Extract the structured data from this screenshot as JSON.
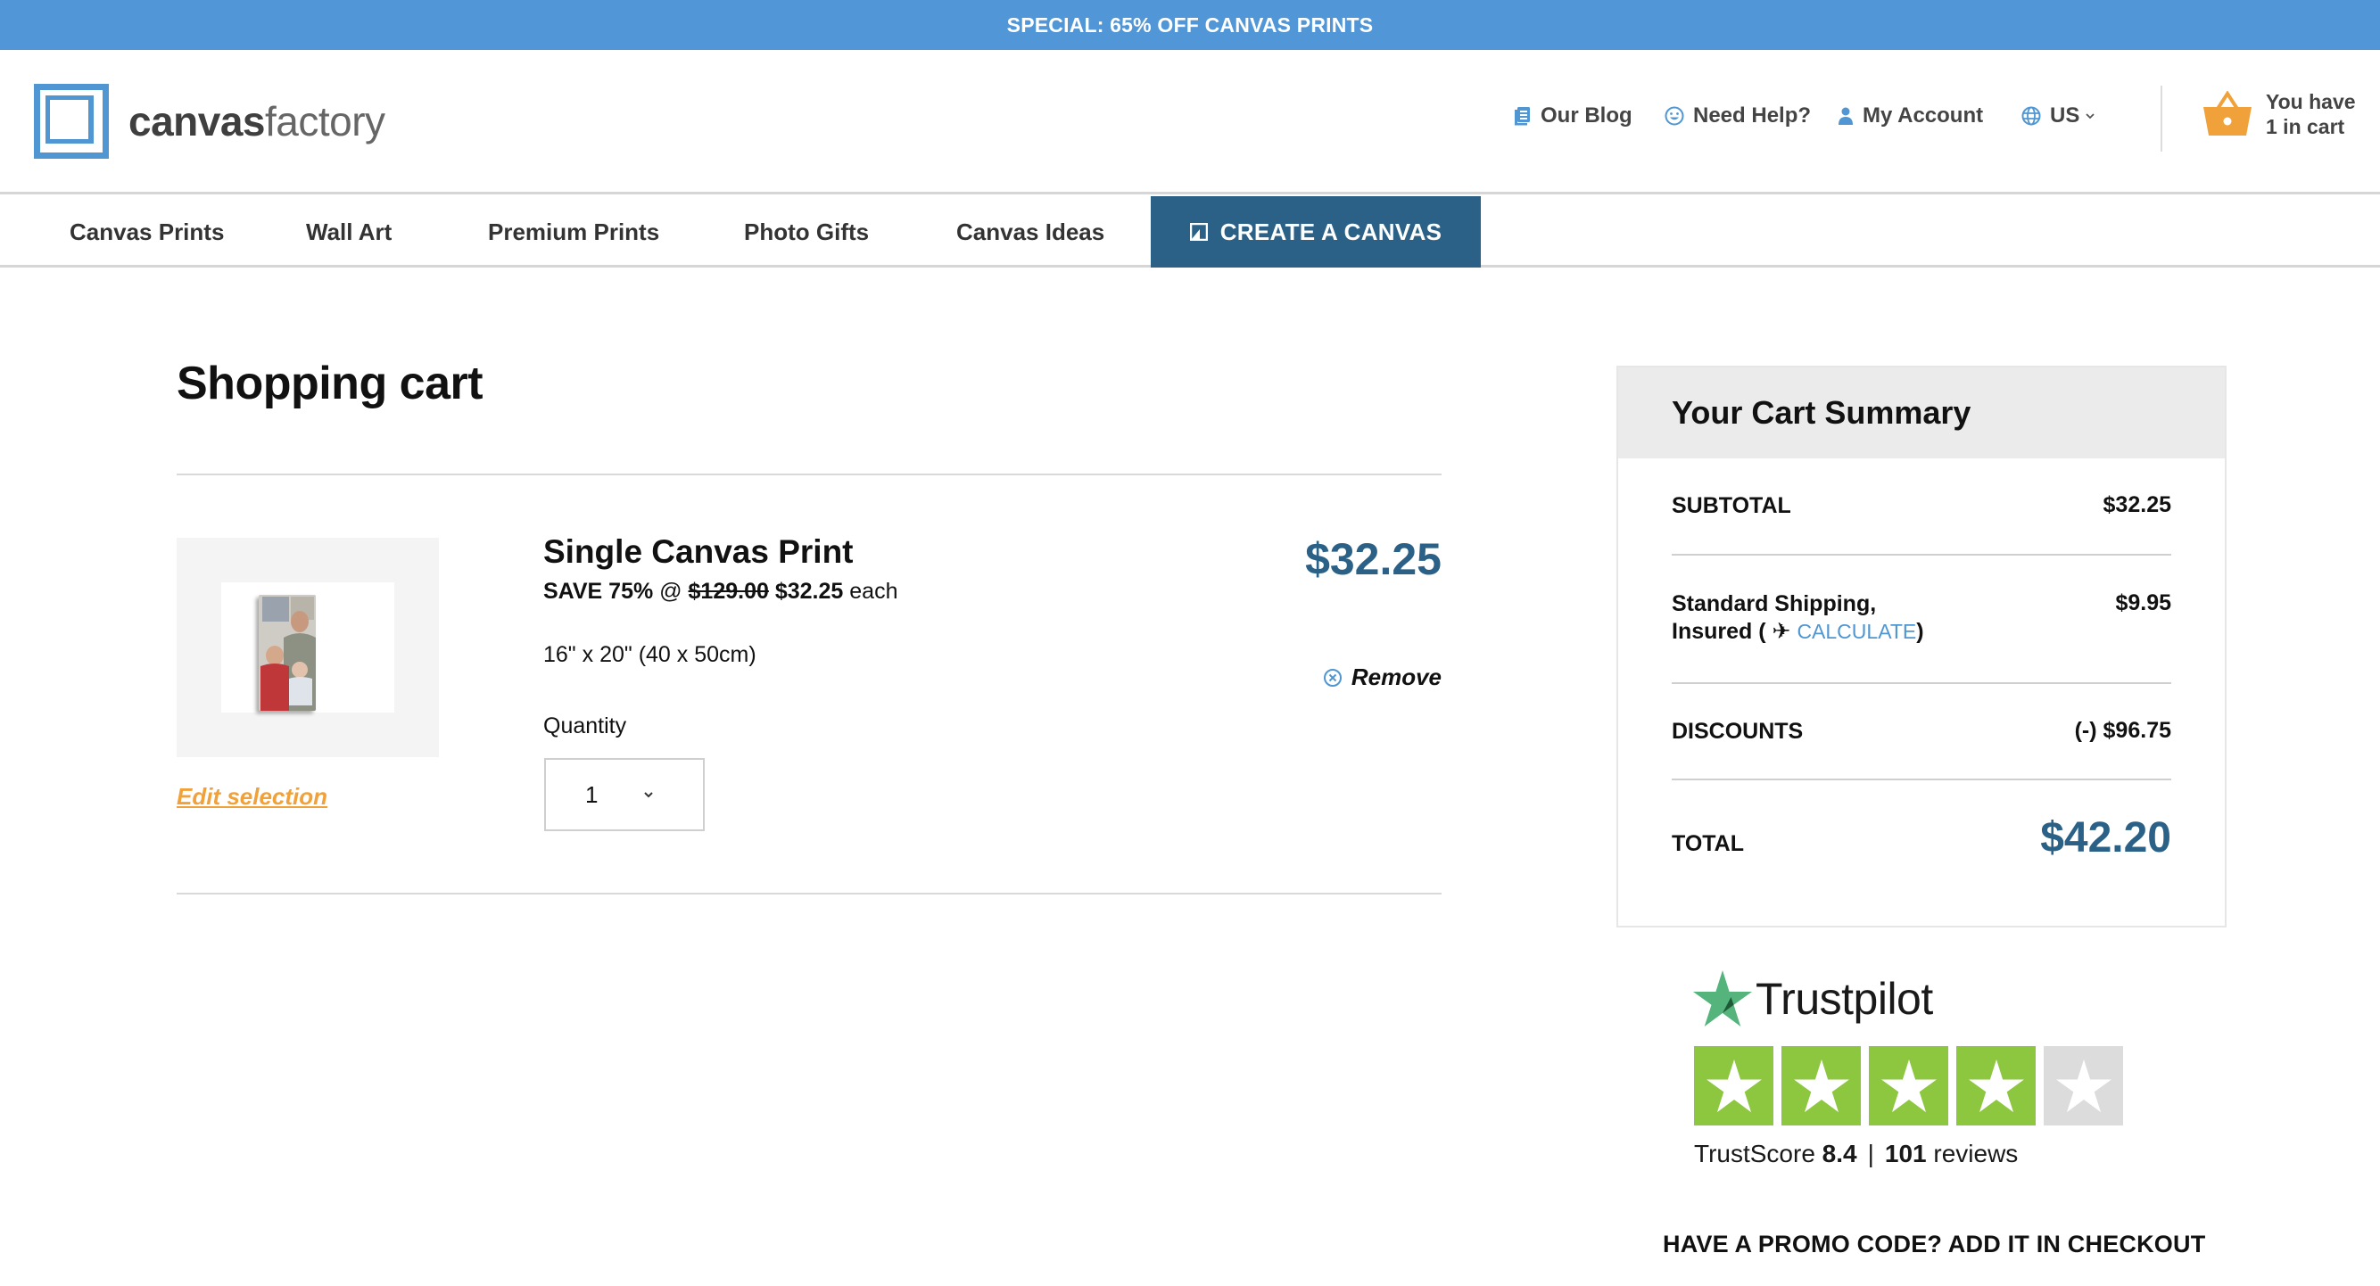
{
  "promo_banner": "SPECIAL: 65% OFF CANVAS PRINTS",
  "brand": {
    "name_bold": "canvas",
    "name_light": "factory",
    "color": "#4f96d2"
  },
  "util_nav": [
    {
      "label": "Our Blog",
      "icon": "book-icon"
    },
    {
      "label": "Need Help?",
      "icon": "smiley-icon"
    },
    {
      "label": "My Account",
      "icon": "user-icon"
    },
    {
      "label": "US",
      "icon": "globe-icon"
    }
  ],
  "cart_mini": {
    "line1": "You have",
    "line2": "1 in cart",
    "icon": "basket-icon"
  },
  "main_nav": {
    "items": [
      "Canvas Prints",
      "Wall Art",
      "Premium Prints",
      "Photo Gifts",
      "Canvas Ideas"
    ],
    "cta": "CREATE A CANVAS"
  },
  "cart": {
    "title": "Shopping cart",
    "items": [
      {
        "name": "Single Canvas Print",
        "save_label": "SAVE 75%",
        "at": "@",
        "original_price": "$129.00",
        "sale_price": "$32.25",
        "each": "each",
        "size": "16\" x 20\" (40 x 50cm)",
        "quantity_label": "Quantity",
        "quantity": "1",
        "line_price": "$32.25",
        "remove_label": "Remove",
        "edit_label": "Edit selection"
      }
    ]
  },
  "summary": {
    "title": "Your Cart Summary",
    "subtotal_label": "SUBTOTAL",
    "subtotal": "$32.25",
    "shipping_label_1": "Standard Shipping,",
    "shipping_label_2": "Insured (",
    "shipping_calc": "CALCULATE",
    "shipping_close": ")",
    "shipping": "$9.95",
    "discounts_label": "DISCOUNTS",
    "discounts": "(-) $96.75",
    "total_label": "TOTAL",
    "total": "$42.20"
  },
  "trustpilot": {
    "name": "Trustpilot",
    "score_label": "TrustScore",
    "score": "8.4",
    "reviews_count": "101",
    "reviews_label": "reviews",
    "stars_filled": 4,
    "stars_total": 5,
    "star_color": "#8dc63f",
    "empty_color": "#dcdcdc"
  },
  "promo_note": "HAVE A PROMO CODE? ADD IT IN CHECKOUT",
  "colors": {
    "banner": "#5196d6",
    "primary": "#2b6187",
    "accent": "#f0a13a",
    "link": "#4f96d2"
  }
}
